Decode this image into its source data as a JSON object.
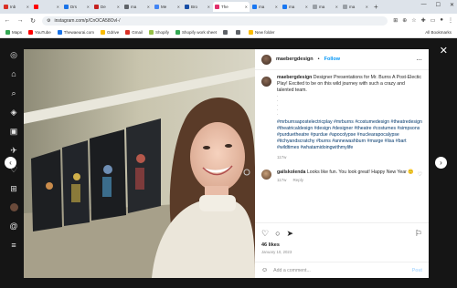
{
  "browser": {
    "tabs": [
      {
        "label": "Inb",
        "color": "#d93025"
      },
      {
        "label": "",
        "color": "#ff0000"
      },
      {
        "label": "Drs",
        "color": "#1a73e8"
      },
      {
        "label": "De",
        "color": "#c5221f"
      },
      {
        "label": "ma",
        "color": "#5f6368"
      },
      {
        "label": "Me",
        "color": "#4285f4"
      },
      {
        "label": "Bro",
        "color": "#174ea6"
      },
      {
        "label": "The",
        "color": "#e1306c"
      },
      {
        "label": "ma",
        "color": "#1877f2"
      },
      {
        "label": "ma",
        "color": "#1877f2"
      },
      {
        "label": "ma",
        "color": "#9aa0a6"
      },
      {
        "label": "ma",
        "color": "#9aa0a6"
      }
    ],
    "active_tab_index": 7,
    "url": "instagram.com/p/CnOCA58OvI-/",
    "bookmarks": [
      {
        "label": "Maps",
        "color": "#34a853"
      },
      {
        "label": "YouTube",
        "color": "#ff0000"
      },
      {
        "label": "Thewaeurai.com",
        "color": "#1a73e8"
      },
      {
        "label": "Gdrive",
        "color": "#fbbc04"
      },
      {
        "label": "Gmail",
        "color": "#d93025"
      },
      {
        "label": "Shopify",
        "color": "#95bf47"
      },
      {
        "label": "Shopify work sheet",
        "color": "#34a853"
      },
      {
        "label": "",
        "color": "#5f6368"
      },
      {
        "label": "",
        "color": "#5f6368"
      },
      {
        "label": "New folder",
        "color": "#fbbc04"
      }
    ],
    "all_bookmarks": "All Bookmarks"
  },
  "post": {
    "username": "maebergdesign",
    "follow": "Follow",
    "more": "...",
    "caption_user": "maebergdesign",
    "caption_text": "Designer Presentations for Mr. Burns A Post-Electic Play! Excited to be on this wild journey with such a crazy and talented team.",
    "caption_dots": [
      ".",
      ".",
      ".",
      ".",
      "."
    ],
    "hashtags": "#mrburnsapostelectricplay #mrburns #costumedesign #theatredesign #theatricaldesign #design #designer #theatre #costumes #simpsons #purduetheatre #purdue #apocolypse #nuclearapocalypse #itchyandscratchy #burns #annewashburn #marge #lisa #bart #wildtimes #whatamidoingwithmylife",
    "caption_age": "117w",
    "comment_user": "gailskolenda",
    "comment_text": "Looks like fun. You look great! Happy New Year",
    "comment_emoji": "🙂",
    "comment_age": "117w",
    "comment_reply": "Reply",
    "likes": "46 likes",
    "date": "January 10, 2023",
    "add_comment_placeholder": "Add a comment...",
    "post_label": "Post"
  }
}
